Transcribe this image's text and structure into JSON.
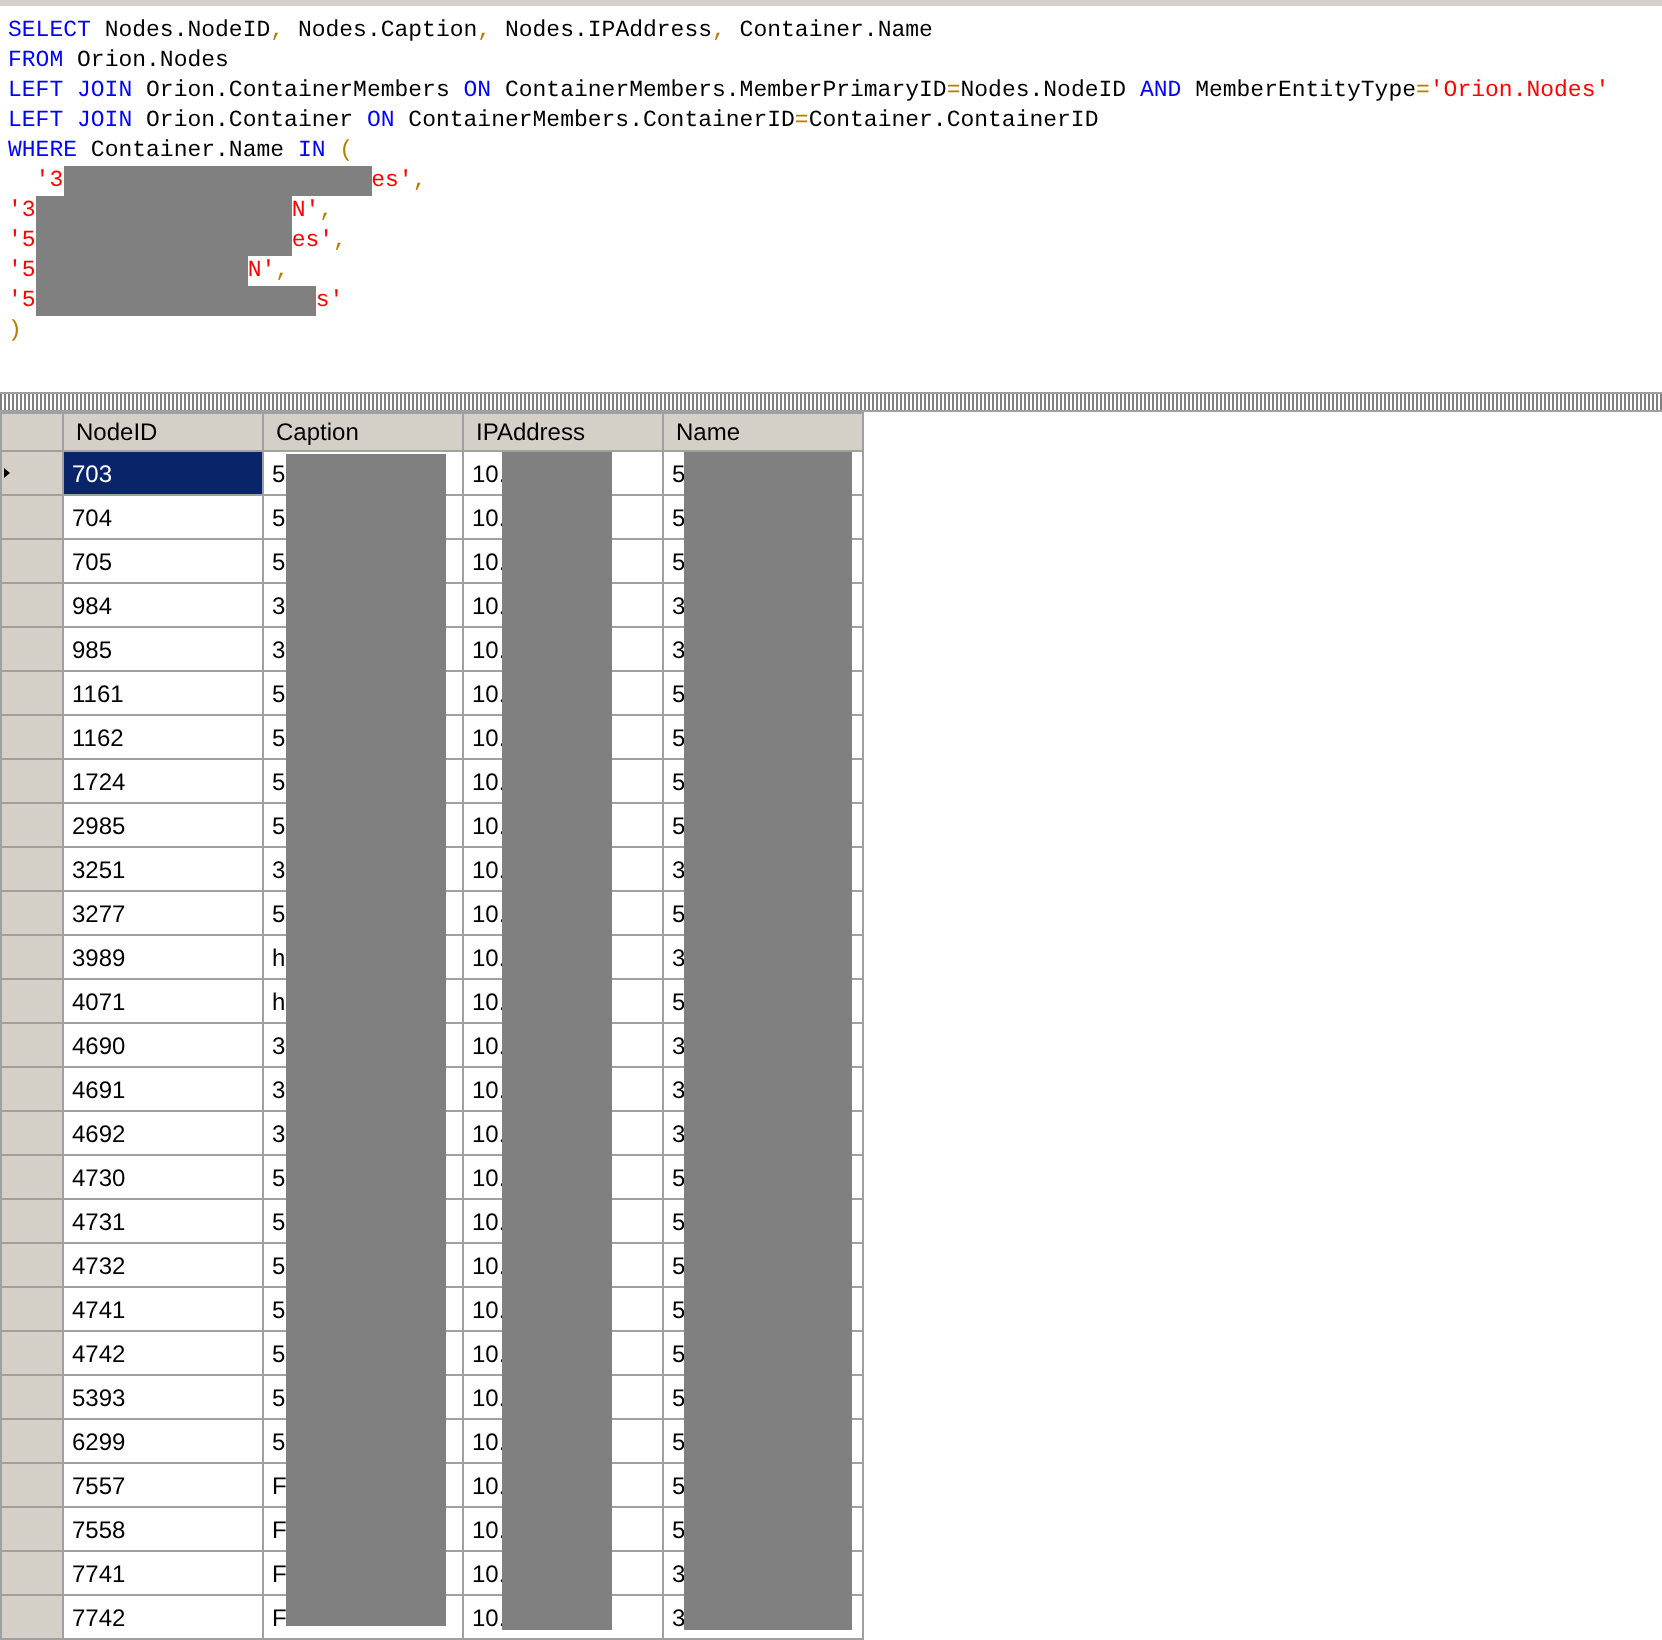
{
  "query_editor": {
    "lines": [
      [
        {
          "text": "SELECT",
          "kind": "keyword"
        },
        {
          "text": " Nodes.NodeID",
          "kind": "text"
        },
        {
          "text": ",",
          "kind": "operator"
        },
        {
          "text": " Nodes.Caption",
          "kind": "text"
        },
        {
          "text": ",",
          "kind": "operator"
        },
        {
          "text": " Nodes.IPAddress",
          "kind": "text"
        },
        {
          "text": ",",
          "kind": "operator"
        },
        {
          "text": " Container.Name",
          "kind": "text"
        }
      ],
      [
        {
          "text": "FROM",
          "kind": "keyword"
        },
        {
          "text": " Orion.Nodes",
          "kind": "text"
        }
      ],
      [
        {
          "text": "LEFT JOIN",
          "kind": "keyword"
        },
        {
          "text": " Orion.ContainerMembers ",
          "kind": "text"
        },
        {
          "text": "ON",
          "kind": "keyword"
        },
        {
          "text": " ContainerMembers.MemberPrimaryID",
          "kind": "text"
        },
        {
          "text": "=",
          "kind": "operator"
        },
        {
          "text": "Nodes.NodeID ",
          "kind": "text"
        },
        {
          "text": "AND",
          "kind": "keyword"
        },
        {
          "text": " MemberEntityType",
          "kind": "text"
        },
        {
          "text": "=",
          "kind": "operator"
        },
        {
          "text": "'Orion.Nodes'",
          "kind": "string"
        }
      ],
      [
        {
          "text": "LEFT JOIN",
          "kind": "keyword"
        },
        {
          "text": " Orion.Container ",
          "kind": "text"
        },
        {
          "text": "ON",
          "kind": "keyword"
        },
        {
          "text": " ContainerMembers.ContainerID",
          "kind": "text"
        },
        {
          "text": "=",
          "kind": "operator"
        },
        {
          "text": "Container.ContainerID",
          "kind": "text"
        }
      ],
      [
        {
          "text": "WHERE",
          "kind": "keyword"
        },
        {
          "text": " Container.Name ",
          "kind": "text"
        },
        {
          "text": "IN",
          "kind": "keyword"
        },
        {
          "text": " (",
          "kind": "operator"
        }
      ],
      [
        {
          "text": "  '3",
          "kind": "string"
        },
        {
          "kind": "redacted"
        },
        {
          "text": "es'",
          "kind": "string"
        },
        {
          "text": ",",
          "kind": "operator"
        }
      ],
      [
        {
          "text": "'3",
          "kind": "string"
        },
        {
          "kind": "redacted"
        },
        {
          "text": "N'",
          "kind": "string"
        },
        {
          "text": ",",
          "kind": "operator"
        }
      ],
      [
        {
          "text": "'5",
          "kind": "string"
        },
        {
          "kind": "redacted"
        },
        {
          "text": "es'",
          "kind": "string"
        },
        {
          "text": ",",
          "kind": "operator"
        }
      ],
      [
        {
          "text": "'5",
          "kind": "string"
        },
        {
          "kind": "redacted"
        },
        {
          "text": "N'",
          "kind": "string"
        },
        {
          "text": ",",
          "kind": "operator"
        }
      ],
      [
        {
          "text": "'5",
          "kind": "string"
        },
        {
          "kind": "redacted"
        },
        {
          "text": "s'",
          "kind": "string"
        }
      ],
      [
        {
          "text": ")",
          "kind": "operator"
        }
      ]
    ]
  },
  "results": {
    "columns": [
      "NodeID",
      "Caption",
      "IPAddress",
      "Name"
    ],
    "rows": [
      {
        "cells": [
          "703",
          "5",
          "10.",
          "5"
        ],
        "selected": true
      },
      {
        "cells": [
          "704",
          "5",
          "10.",
          "5"
        ],
        "selected": false
      },
      {
        "cells": [
          "705",
          "5",
          "10.",
          "5"
        ],
        "selected": false
      },
      {
        "cells": [
          "984",
          "3",
          "10.",
          "3"
        ],
        "selected": false
      },
      {
        "cells": [
          "985",
          "3",
          "10.",
          "3"
        ],
        "selected": false
      },
      {
        "cells": [
          "1161",
          "5",
          "10.",
          "5"
        ],
        "selected": false
      },
      {
        "cells": [
          "1162",
          "5",
          "10.",
          "5"
        ],
        "selected": false
      },
      {
        "cells": [
          "1724",
          "5",
          "10.",
          "5"
        ],
        "selected": false
      },
      {
        "cells": [
          "2985",
          "5",
          "10.",
          "5"
        ],
        "selected": false
      },
      {
        "cells": [
          "3251",
          "3",
          "10.",
          "3"
        ],
        "selected": false
      },
      {
        "cells": [
          "3277",
          "5",
          "10.",
          "5"
        ],
        "selected": false
      },
      {
        "cells": [
          "3989",
          "h",
          "10.",
          "3"
        ],
        "selected": false
      },
      {
        "cells": [
          "4071",
          "h",
          "10.",
          "5"
        ],
        "selected": false
      },
      {
        "cells": [
          "4690",
          "3",
          "10.",
          "3"
        ],
        "selected": false
      },
      {
        "cells": [
          "4691",
          "3",
          "10.",
          "3"
        ],
        "selected": false
      },
      {
        "cells": [
          "4692",
          "3",
          "10.",
          "3"
        ],
        "selected": false
      },
      {
        "cells": [
          "4730",
          "5",
          "10.",
          "5"
        ],
        "selected": false
      },
      {
        "cells": [
          "4731",
          "5",
          "10.",
          "5"
        ],
        "selected": false
      },
      {
        "cells": [
          "4732",
          "5",
          "10.",
          "5"
        ],
        "selected": false
      },
      {
        "cells": [
          "4741",
          "5",
          "10.",
          "5"
        ],
        "selected": false
      },
      {
        "cells": [
          "4742",
          "5",
          "10.",
          "5"
        ],
        "selected": false
      },
      {
        "cells": [
          "5393",
          "5",
          "10.",
          "5"
        ],
        "selected": false
      },
      {
        "cells": [
          "6299",
          "5",
          "10.",
          "5"
        ],
        "selected": false
      },
      {
        "cells": [
          "7557",
          "F",
          "10.",
          "5"
        ],
        "selected": false
      },
      {
        "cells": [
          "7558",
          "F",
          "10.",
          "5"
        ],
        "selected": false
      },
      {
        "cells": [
          "7741",
          "F",
          "10.",
          "3"
        ],
        "selected": false
      },
      {
        "cells": [
          "7742",
          "F",
          "10.",
          "3"
        ],
        "selected": false
      }
    ]
  }
}
